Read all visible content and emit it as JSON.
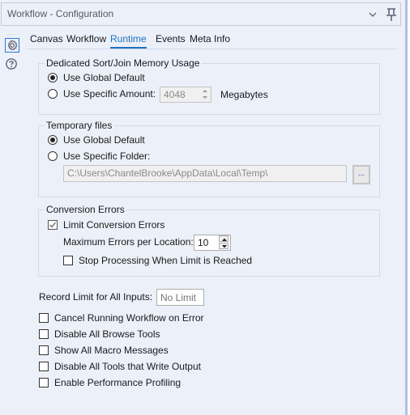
{
  "window": {
    "title": "Workflow - Configuration",
    "collapse_icon": "chevron-down-icon",
    "pin_icon": "pin-icon"
  },
  "sidebar": {
    "overflow": "...",
    "items": [
      {
        "name": "configuration",
        "icon": "gear-icon",
        "active": true
      },
      {
        "name": "help",
        "icon": "help-icon",
        "active": false
      }
    ]
  },
  "tabs": [
    {
      "label": "Canvas",
      "active": false
    },
    {
      "label": "Workflow",
      "active": false
    },
    {
      "label": "Runtime",
      "active": true
    },
    {
      "label": "Events",
      "active": false
    },
    {
      "label": "Meta Info",
      "active": false
    }
  ],
  "memory": {
    "title": "Dedicated Sort/Join Memory Usage",
    "options": [
      {
        "label": "Use Global Default",
        "selected": true
      },
      {
        "label": "Use Specific Amount:",
        "selected": false
      }
    ],
    "amount_value": "4048",
    "unit": "Megabytes"
  },
  "temp_files": {
    "title": "Temporary files",
    "options": [
      {
        "label": "Use Global Default",
        "selected": true
      },
      {
        "label": "Use Specific Folder:",
        "selected": false
      }
    ],
    "folder_path": "C:\\Users\\ChantelBrooke\\AppData\\Local\\Temp\\",
    "browse_label": "..."
  },
  "conversion_errors": {
    "title": "Conversion Errors",
    "limit_label": "Limit Conversion Errors",
    "limit_checked": true,
    "max_label": "Maximum Errors per Location:",
    "max_value": "10",
    "stop_label": "Stop Processing When Limit is Reached",
    "stop_checked": false
  },
  "record_limit": {
    "label": "Record Limit for All Inputs:",
    "placeholder": "No Limit"
  },
  "options": [
    {
      "label": "Cancel Running Workflow on Error",
      "checked": false
    },
    {
      "label": "Disable All Browse Tools",
      "checked": false
    },
    {
      "label": "Show All Macro Messages",
      "checked": false
    },
    {
      "label": "Disable All Tools that Write Output",
      "checked": false
    },
    {
      "label": "Enable Performance Profiling",
      "checked": false
    }
  ]
}
